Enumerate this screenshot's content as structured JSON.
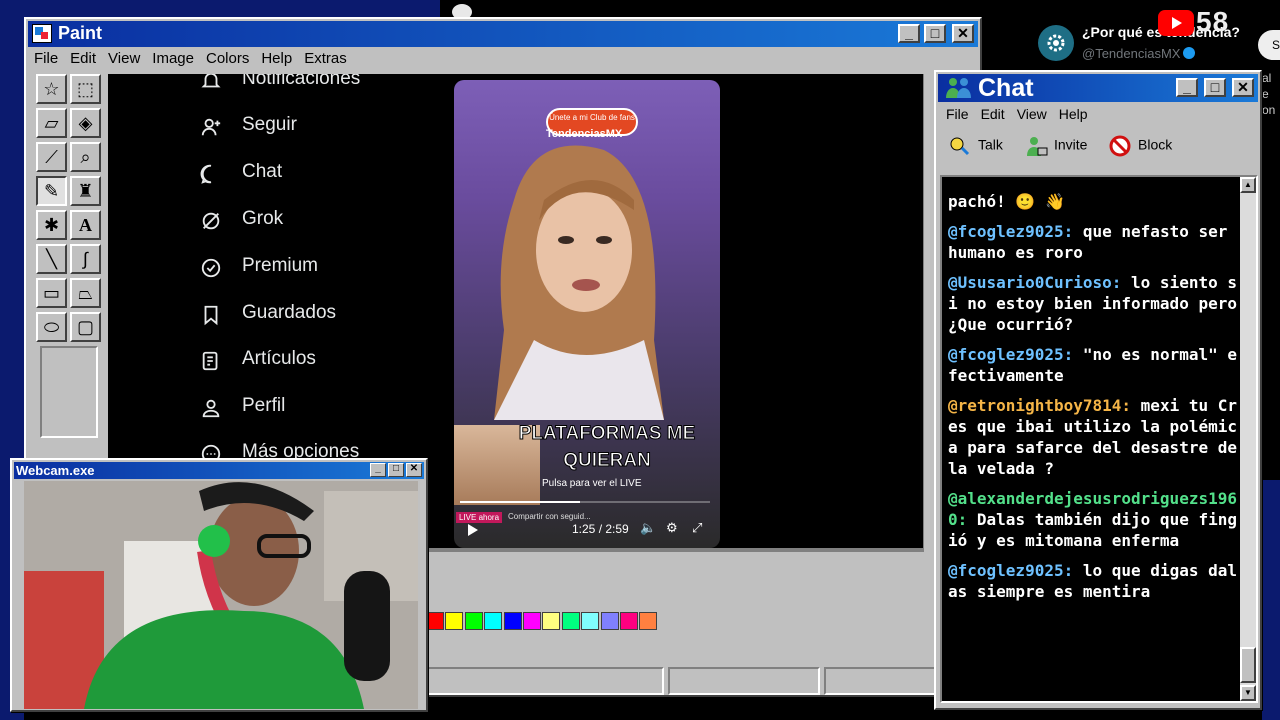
{
  "background": {
    "trend_title": "¿Por qué es tendencia?",
    "trend_handle": "@TendenciasMX",
    "stream_count": "58",
    "button_label": "S",
    "side_text": [
      "al e",
      "on"
    ]
  },
  "paint": {
    "title": "Paint",
    "menu": [
      "File",
      "Edit",
      "View",
      "Image",
      "Colors",
      "Help",
      "Extras"
    ],
    "nav_items": [
      {
        "label": "Notificaciones",
        "icon": "bell-icon"
      },
      {
        "label": "Seguir",
        "icon": "follow-icon"
      },
      {
        "label": "Chat",
        "icon": "chat-bubble-icon"
      },
      {
        "label": "Grok",
        "icon": "grok-icon"
      },
      {
        "label": "Premium",
        "icon": "premium-icon"
      },
      {
        "label": "Guardados",
        "icon": "bookmark-icon"
      },
      {
        "label": "Artículos",
        "icon": "articles-icon"
      },
      {
        "label": "Perfil",
        "icon": "profile-icon"
      },
      {
        "label": "Más opciones",
        "icon": "more-icon"
      }
    ],
    "video": {
      "badge": "Únete a mi Club de fans",
      "tag": "TendenciasMX",
      "caption_line1": "PLATAFORMAS ME",
      "caption_line2": "QUIERAN",
      "pulsa": "Pulsa para ver el LIVE",
      "live": "LIVE ahora",
      "share": "Compartir con seguid...",
      "time": "1:25 / 2:59",
      "progress": 0.48
    },
    "palette": [
      "#ff0000",
      "#ffff00",
      "#00ff00",
      "#00ffff",
      "#0000ff",
      "#ff00ff",
      "#ffff80",
      "#00ff80",
      "#80ffff",
      "#8080ff",
      "#ff0080",
      "#ff8040"
    ]
  },
  "chat": {
    "title": "Chat",
    "menu": [
      "File",
      "Edit",
      "View",
      "Help"
    ],
    "toolbar": {
      "talk": "Talk",
      "invite": "Invite",
      "block": "Block"
    },
    "messages": [
      {
        "user": "",
        "text": "pachó! 🙂 👋",
        "color": "blue"
      },
      {
        "user": "@fcoglez9025:",
        "text": "que nefasto ser humano es roro",
        "color": "blue"
      },
      {
        "user": "@Ususario0Curioso:",
        "text": "lo siento si no estoy bien informado pero ¿Que ocurrió?",
        "color": "blue"
      },
      {
        "user": "@fcoglez9025:",
        "text": "\"no es normal\" efectivamente",
        "color": "blue"
      },
      {
        "user": "@retronightboy7814:",
        "text": "mexi tu Cres que ibai utilizo la polémica para safarce del desastre de la velada ?",
        "color": "orange"
      },
      {
        "user": "@alexanderdejesusrodriguezs1960:",
        "text": "Dalas también dijo que fingió y es mitomana enferma",
        "color": "green"
      },
      {
        "user": "@fcoglez9025:",
        "text": "lo que digas dalas siempre es mentira",
        "color": "blue"
      }
    ]
  },
  "webcam": {
    "title": "Webcam.exe"
  }
}
